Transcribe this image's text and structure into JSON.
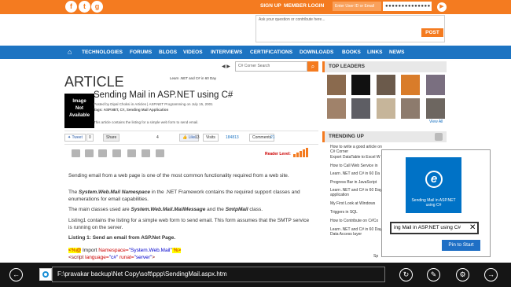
{
  "header": {
    "social_icons": [
      "facebook-icon",
      "twitter-icon",
      "google-plus-icon"
    ],
    "sign_up": "SIGN UP",
    "member_login": "MEMBER LOGIN",
    "user_id_placeholder": "Enter User ID or Email",
    "password_mask": "●●●●●●●●●●●●●●",
    "ask_placeholder": "Ask your question or contribute here...",
    "post_label": "POST"
  },
  "nav": {
    "items": [
      "TECHNOLOGIES",
      "FORUMS",
      "BLOGS",
      "VIDEOS",
      "INTERVIEWS",
      "CERTIFICATIONS",
      "DOWNLOADS",
      "BOOKS",
      "LINKS",
      "NEWS"
    ]
  },
  "search": {
    "placeholder": "C# Corner Search",
    "arrows": "◀ ▶"
  },
  "article": {
    "section": "ARTICLE",
    "promo": "Learn .NET and C# in 60 Day",
    "thumb_text": [
      "Image",
      "Not",
      "Available"
    ],
    "title": "Sending Mail in ASP.NET using C#",
    "posted_by": "Posted by Dipal Choksi in Articles | ASP.NET Programming on July 15, 2001",
    "tags": "Tags: ASP.NET, C#, Sending Mail Application",
    "excerpt": "This article contains the listing for a simple web form to send email.",
    "tweet": "Tweet",
    "tweet_count": "0",
    "share": "Share",
    "share_count": "4",
    "like": "Like",
    "like_count": "13",
    "views_label": "Visits",
    "views_count": "184813",
    "comments_label": "Comments",
    "comments_count": "21",
    "reader_level": "Reader Level:",
    "reader_level_bars": 5
  },
  "body": {
    "p1": "Sending email from a web page is one of the most common functionality required from a web site.",
    "p2_pre": "The ",
    "p2_ns": "System.Web.Mail Namespace",
    "p2_post": " in the .NET Framework contains the required support classes and enumerations for email capabilities.",
    "p3_pre": "The main classes used are ",
    "p3_c1": "System.Web.Mail.MailMessage",
    "p3_mid": " and the ",
    "p3_c2": "SmtpMail",
    "p3_post": " class.",
    "p4": "Listing1 contains the listing for a simple web form to send email. This form assumes that the SMTP service is running on the server.",
    "listing_title": "Listing 1: Send an email from ASP.Net Page.",
    "code1_open": "<%@",
    "code1_import": " Import ",
    "code1_attr": "Namespace=",
    "code1_val": "\"System.Web.Mail\"",
    "code1_close": " %>",
    "code2_tag": "<script",
    "code2_attr1": " language=",
    "code2_val1": "\"c#\"",
    "code2_attr2": " runat=",
    "code2_val2": "\"server\"",
    "code2_end": ">"
  },
  "sidebar": {
    "top_leaders": "TOP LEADERS",
    "view_all": "View All",
    "trending": "TRENDING UP",
    "trending_items": [
      "How to write a good article on C# Corner",
      "Export DataTable to Excel W",
      "How to Call Web Service in",
      "Learn .NET and C# in 60 Da",
      "Progress Bar in JavaScript",
      "Learn .NET and C# in 60 Day application",
      "My First Look at Windows",
      "Triggers in SQL",
      "How to Contribute on C#Co",
      "Learn .NET and C# in 60 Day to Data Access layer"
    ],
    "truncated": "Sp"
  },
  "pin_flyout": {
    "tile_caption": "Sending Mail in ASP.NET using C#",
    "name_value": "ing Mail in ASP.NET using C#",
    "pin_button": "Pin to Start"
  },
  "appbar": {
    "address": "F:\\pravakar backup\\Net Copy\\soft\\ppp\\SendingMail.aspx.htm",
    "icons": [
      "back-icon",
      "refresh-icon",
      "pin-icon",
      "wrench-icon",
      "forward-icon"
    ]
  },
  "colors": {
    "brand_orange": "#f47b20",
    "nav_blue": "#1d74c2",
    "tile_blue": "#0072c6",
    "appbar_black": "#151515"
  }
}
